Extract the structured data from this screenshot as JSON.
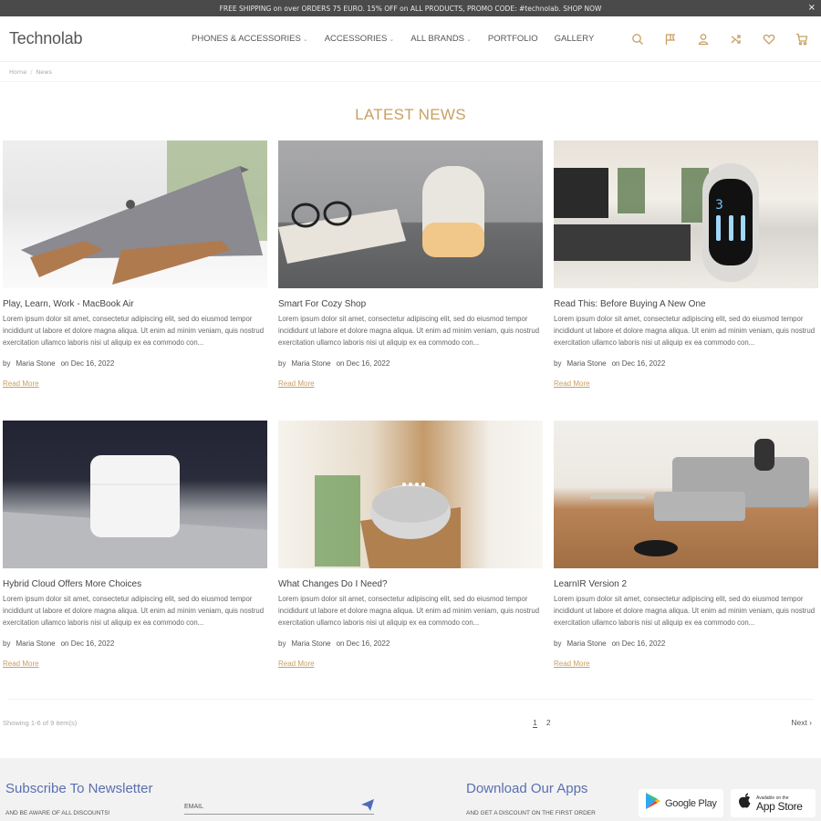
{
  "promo_bar": {
    "text": "FREE SHIPPING on over ORDERS 75 EURO. 15% OFF on ALL PRODUCTS, PROMO CODE: #technolab. SHOP NOW",
    "close_label": "×"
  },
  "header": {
    "logo": "Technolab",
    "nav": [
      {
        "label": "PHONES & ACCESSORIES",
        "has_dropdown": true
      },
      {
        "label": "ACCESSORIES",
        "has_dropdown": true
      },
      {
        "label": "ALL BRANDS",
        "has_dropdown": true
      },
      {
        "label": "PORTFOLIO",
        "has_dropdown": false
      },
      {
        "label": "GALLERY",
        "has_dropdown": false
      }
    ],
    "chevron": "⌄",
    "icons": [
      "search-icon",
      "flag-icon",
      "user-icon",
      "shuffle-icon",
      "heart-icon",
      "cart-icon"
    ],
    "accent_color": "#c8a062"
  },
  "breadcrumb": {
    "items": [
      "Home",
      "News"
    ],
    "separator": "/"
  },
  "page": {
    "title": "LATEST NEWS"
  },
  "posts": [
    {
      "title": "Play, Learn, Work - MacBook Air",
      "excerpt": "Lorem ipsum dolor sit amet, consectetur adipiscing elit, sed do eiusmod tempor incididunt ut labore et dolore magna aliqua. Ut enim ad minim veniam, quis nostrud exercitation ullamco laboris nisi ut aliquip ex ea commodo con...",
      "by": "by",
      "author": "Maria Stone",
      "date": "on Dec 16, 2022",
      "read_more": "Read More",
      "image": "macbook-on-wooden-stand"
    },
    {
      "title": "Smart For Cozy Shop",
      "excerpt": "Lorem ipsum dolor sit amet, consectetur adipiscing elit, sed do eiusmod tempor incididunt ut labore et dolore magna aliqua. Ut enim ad minim veniam, quis nostrud exercitation ullamco laboris nisi ut aliquip ex ea commodo con...",
      "by": "by",
      "author": "Maria Stone",
      "date": "on Dec 16, 2022",
      "read_more": "Read More",
      "image": "smart-lamp-with-glasses"
    },
    {
      "title": "Read This: Before Buying A New One",
      "excerpt": "Lorem ipsum dolor sit amet, consectetur adipiscing elit, sed do eiusmod tempor incididunt ut labore et dolore magna aliqua. Ut enim ad minim veniam, quis nostrud exercitation ullamco laboris nisi ut aliquip ex ea commodo con...",
      "by": "by",
      "author": "Maria Stone",
      "date": "on Dec 16, 2022",
      "read_more": "Read More",
      "image": "kitchen-smart-display"
    },
    {
      "title": "Hybrid Cloud Offers More Choices",
      "excerpt": "Lorem ipsum dolor sit amet, consectetur adipiscing elit, sed do eiusmod tempor incididunt ut labore et dolore magna aliqua. Ut enim ad minim veniam, quis nostrud exercitation ullamco laboris nisi ut aliquip ex ea commodo con...",
      "by": "by",
      "author": "Maria Stone",
      "date": "on Dec 16, 2022",
      "read_more": "Read More",
      "image": "earbuds-case-on-laptop"
    },
    {
      "title": "What Changes Do I Need?",
      "excerpt": "Lorem ipsum dolor sit amet, consectetur adipiscing elit, sed do eiusmod tempor incididunt ut labore et dolore magna aliqua. Ut enim ad minim veniam, quis nostrud exercitation ullamco laboris nisi ut aliquip ex ea commodo con...",
      "by": "by",
      "author": "Maria Stone",
      "date": "on Dec 16, 2022",
      "read_more": "Read More",
      "image": "smart-speaker-on-shelf"
    },
    {
      "title": "LearnIR Version 2",
      "excerpt": "Lorem ipsum dolor sit amet, consectetur adipiscing elit, sed do eiusmod tempor incididunt ut labore et dolore magna aliqua. Ut enim ad minim veniam, quis nostrud exercitation ullamco laboris nisi ut aliquip ex ea commodo con...",
      "by": "by",
      "author": "Maria Stone",
      "date": "on Dec 16, 2022",
      "read_more": "Read More",
      "image": "robot-vacuum-living-room"
    }
  ],
  "pagination": {
    "summary": "Showing 1-6 of 9 item(s)",
    "pages": [
      "1",
      "2"
    ],
    "current": "1",
    "next_label": "Next ›"
  },
  "footer": {
    "newsletter_title": "Subscribe To Newsletter",
    "newsletter_sub": "AND BE AWARE OF ALL DISCOUNTS!",
    "email_placeholder": "EMAIL",
    "apps_title": "Download Our Apps",
    "apps_sub": "AND GET A DISCOUNT ON THE FIRST ORDER",
    "google_play": "Google Play",
    "app_store_small": "Available on the",
    "app_store": "App Store",
    "title_color": "#5a6fb0"
  }
}
